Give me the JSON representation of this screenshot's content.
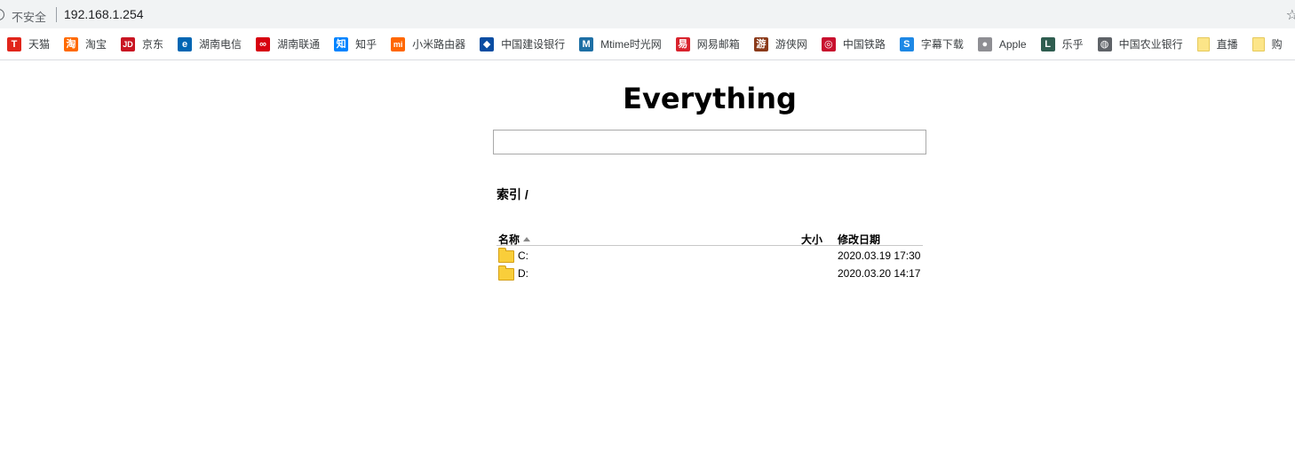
{
  "browser": {
    "insecure_label": "不安全",
    "url": "192.168.1.254",
    "bookmark_star_icon": "star-icon"
  },
  "bookmarks": [
    {
      "label": "天猫",
      "icon": "tmall-icon",
      "glyph": "T",
      "color": "#e1251b"
    },
    {
      "label": "淘宝",
      "icon": "taobao-icon",
      "glyph": "淘",
      "color": "#ff6a00"
    },
    {
      "label": "京东",
      "icon": "jd-icon",
      "glyph": "JD",
      "color": "#c91623"
    },
    {
      "label": "湖南电信",
      "icon": "telecom-icon",
      "glyph": "e",
      "color": "#0066b3"
    },
    {
      "label": "湖南联通",
      "icon": "unicom-icon",
      "glyph": "∞",
      "color": "#d7000f"
    },
    {
      "label": "知乎",
      "icon": "zhihu-icon",
      "glyph": "知",
      "color": "#0084ff"
    },
    {
      "label": "小米路由器",
      "icon": "mi-icon",
      "glyph": "mi",
      "color": "#ff6700"
    },
    {
      "label": "中国建设银行",
      "icon": "ccb-icon",
      "glyph": "◆",
      "color": "#0a4da2"
    },
    {
      "label": "Mtime时光网",
      "icon": "mtime-icon",
      "glyph": "M",
      "color": "#1d6fa5"
    },
    {
      "label": "网易邮箱",
      "icon": "netease-icon",
      "glyph": "易",
      "color": "#d9232d"
    },
    {
      "label": "游侠网",
      "icon": "ali213-icon",
      "glyph": "游",
      "color": "#8b3a1a"
    },
    {
      "label": "中国铁路",
      "icon": "railway-icon",
      "glyph": "◎",
      "color": "#c8102e"
    },
    {
      "label": "字幕下载",
      "icon": "subtitle-icon",
      "glyph": "S",
      "color": "#1e88e5"
    },
    {
      "label": "Apple",
      "icon": "apple-icon",
      "glyph": "●",
      "color": "#8e8e93"
    },
    {
      "label": "乐乎",
      "icon": "lofter-icon",
      "glyph": "L",
      "color": "#2f5d50"
    },
    {
      "label": "中国农业银行",
      "icon": "globe-icon",
      "glyph": "◍",
      "color": "#5f6368"
    },
    {
      "label": "直播",
      "icon": "folder-icon",
      "glyph": "",
      "color": ""
    },
    {
      "label": "购",
      "icon": "folder-icon",
      "glyph": "",
      "color": ""
    }
  ],
  "page": {
    "title": "Everything",
    "search_value": "",
    "index_heading": "索引 /",
    "columns": {
      "name": "名称",
      "size": "大小",
      "modified": "修改日期"
    },
    "rows": [
      {
        "name": "C:",
        "size": "",
        "modified": "2020.03.19 17:30"
      },
      {
        "name": "D:",
        "size": "",
        "modified": "2020.03.20 14:17"
      }
    ]
  }
}
